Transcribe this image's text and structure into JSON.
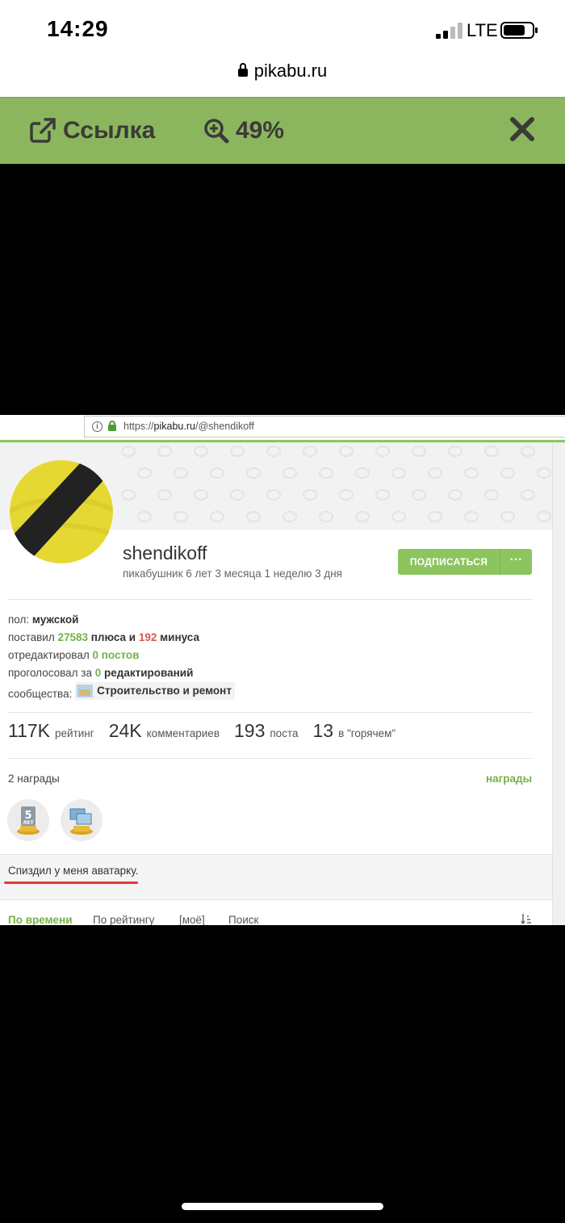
{
  "status_bar": {
    "time": "14:29",
    "network": "LTE",
    "battery_level": 0.75
  },
  "browser": {
    "domain": "pikabu.ru"
  },
  "toolbar": {
    "link_label": "Ссылка",
    "zoom_label": "49%"
  },
  "screenshot": {
    "address_bar": {
      "url_prefix": "https://",
      "url_host": "pikabu.ru",
      "url_path": "/@shendikoff"
    },
    "profile": {
      "username": "shendikoff",
      "since": "пикабушник 6 лет 3 месяца 1 неделю 3 дня",
      "subscribe_label": "ПОДПИСАТЬСЯ",
      "more_label": "···",
      "info": {
        "gender_label": "пол:",
        "gender_value": "мужской",
        "voted_label": "поставил",
        "plus_value": "27583",
        "plus_label": "плюса и",
        "minus_value": "192",
        "minus_label": "минуса",
        "edited_label": "отредактировал",
        "edited_value": "0 постов",
        "votes_label": "проголосовал за",
        "votes_value": "0",
        "votes_suffix": "редактирований",
        "communities_label": "сообщества:",
        "community_name": "Строительство и ремонт"
      },
      "stats": [
        {
          "value": "117K",
          "label": "рейтинг"
        },
        {
          "value": "24K",
          "label": "комментариев"
        },
        {
          "value": "193",
          "label": "поста"
        },
        {
          "value": "13",
          "label": "в \"горячем\""
        }
      ],
      "awards": {
        "title": "2 награды",
        "link": "награды"
      },
      "comment": "Спиздил у меня аватарку."
    },
    "tabs": [
      "По времени",
      "По рейтингу",
      "[моё]",
      "Поиск"
    ]
  }
}
